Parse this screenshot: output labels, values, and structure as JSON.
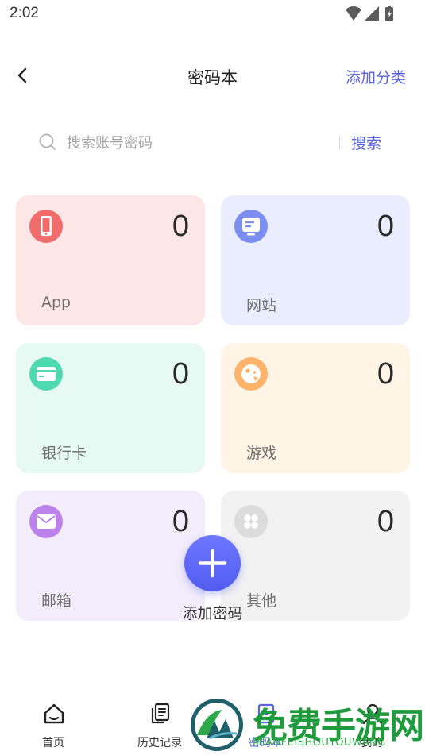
{
  "status_bar": {
    "time": "2:02",
    "icons": [
      "wifi-icon",
      "cellular-signal-icon",
      "battery-icon"
    ]
  },
  "nav": {
    "back_icon": "chevron-left-icon",
    "title": "密码本",
    "action": "添加分类"
  },
  "search": {
    "placeholder": "搜索账号密码",
    "value": "",
    "button": "搜索",
    "icon": "search-icon"
  },
  "categories": [
    {
      "label": "App",
      "count": "0",
      "icon": "phone-icon",
      "bg": "#fde6e6",
      "icon_color": "#f26c6c"
    },
    {
      "label": "网站",
      "count": "0",
      "icon": "monitor-icon",
      "bg": "#e9edfd",
      "icon_color": "#7d8ef2"
    },
    {
      "label": "银行卡",
      "count": "0",
      "icon": "card-icon",
      "bg": "#e6f9f3",
      "icon_color": "#4fd9b0"
    },
    {
      "label": "游戏",
      "count": "0",
      "icon": "game-icon",
      "bg": "#fff4e6",
      "icon_color": "#fdb36b"
    },
    {
      "label": "邮箱",
      "count": "0",
      "icon": "mail-icon",
      "bg": "#f3ecfb",
      "icon_color": "#bc82ec"
    },
    {
      "label": "其他",
      "count": "0",
      "icon": "grid-icon",
      "bg": "#f2f2f2",
      "icon_color": "#dcdcdc"
    }
  ],
  "fab": {
    "label": "添加密码",
    "icon": "plus-icon",
    "color": "#5a62e6"
  },
  "tabbar": {
    "items": [
      {
        "label": "首页",
        "icon": "home-icon"
      },
      {
        "label": "历史记录",
        "icon": "history-icon"
      },
      {
        "label": "密码本",
        "icon": "password-book-icon"
      },
      {
        "label": "我的",
        "icon": "profile-icon"
      }
    ]
  },
  "watermark": {
    "title": "免费手游网",
    "subtitle": "MIANFEISHOUYOUWANG"
  }
}
